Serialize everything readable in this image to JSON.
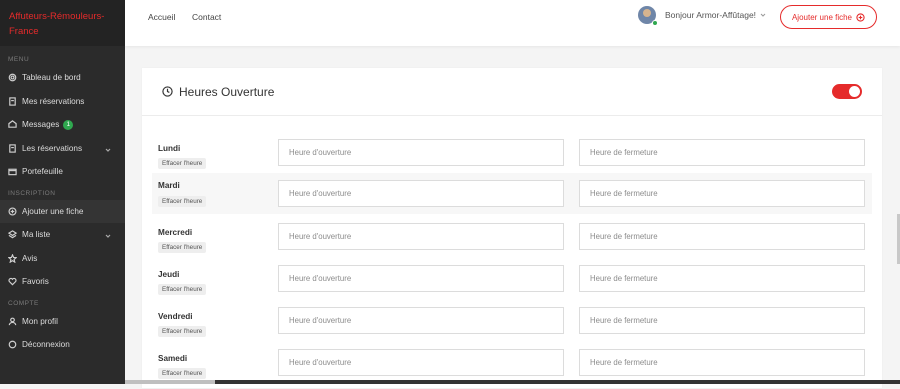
{
  "brand": {
    "title": "Affuteurs-Rémouleurs-France"
  },
  "sidebar": {
    "sections": [
      "MENU",
      "INSCRIPTION",
      "COMPTE"
    ],
    "menu": [
      {
        "label": "Tableau de bord",
        "icon": "gear-icon"
      },
      {
        "label": "Mes réservations",
        "icon": "document-icon"
      },
      {
        "label": "Messages",
        "icon": "message-icon",
        "badge": "1"
      },
      {
        "label": "Les réservations",
        "icon": "document-icon"
      },
      {
        "label": "Portefeuille",
        "icon": "wallet-icon"
      }
    ],
    "inscription": [
      {
        "label": "Ajouter une fiche",
        "icon": "plus-circle-icon"
      },
      {
        "label": "Ma liste",
        "icon": "layers-icon"
      },
      {
        "label": "Avis",
        "icon": "star-icon"
      },
      {
        "label": "Favoris",
        "icon": "heart-icon"
      }
    ],
    "compte": [
      {
        "label": "Mon profil",
        "icon": "user-icon"
      },
      {
        "label": "Déconnexion",
        "icon": "power-icon"
      }
    ]
  },
  "topbar": {
    "nav": [
      "Accueil",
      "Contact"
    ],
    "user_greeting": "Bonjour Armor-Affûtage!",
    "add_button": "Ajouter une fiche"
  },
  "card": {
    "title": "Heures Ouverture",
    "clear_label": "Effacer l'heure",
    "open_placeholder": "Heure d'ouverture",
    "close_placeholder": "Heure de fermeture",
    "days": [
      "Lundi",
      "Mardi",
      "Mercredi",
      "Jeudi",
      "Vendredi",
      "Samedi"
    ]
  },
  "colors": {
    "accent": "#e52b2b",
    "sidebar_bg": "#2b2b2b",
    "badge": "#2fa84f"
  }
}
